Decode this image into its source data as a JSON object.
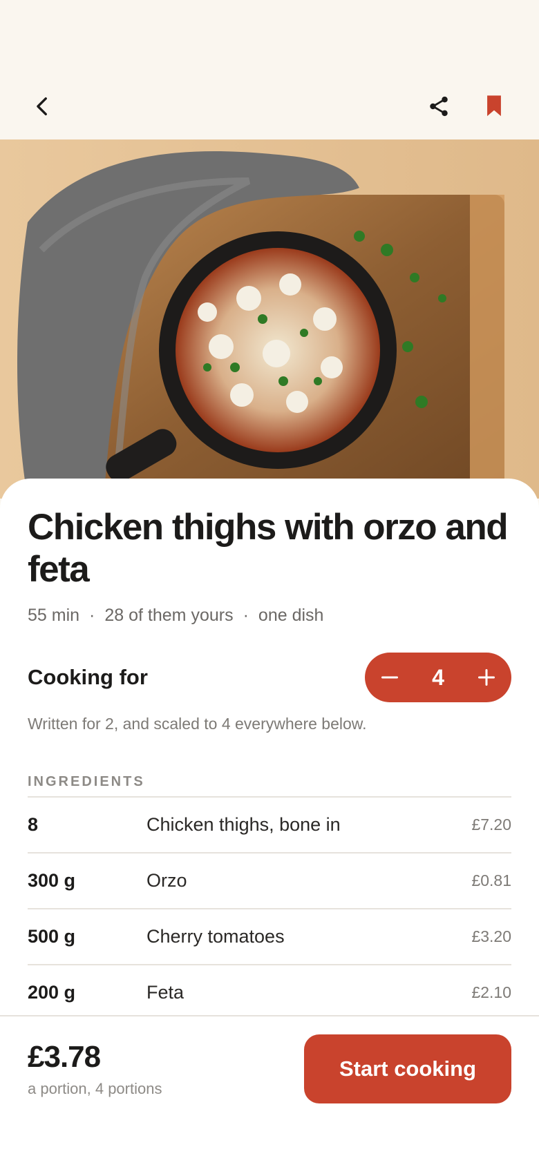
{
  "header": {
    "back_icon": "chevron-left-icon",
    "share_icon": "share-icon",
    "bookmark_icon": "bookmark-icon",
    "accent": "#c9432d"
  },
  "recipe": {
    "title": "Chicken thighs with orzo and feta",
    "time": "55 min",
    "active": "28 of them yours",
    "equipment": "one dish",
    "separator": "·"
  },
  "servings": {
    "label": "Cooking for",
    "value": "4",
    "minus_icon": "minus-icon",
    "plus_icon": "plus-icon",
    "note": "Written for 2, and scaled to 4 everywhere below."
  },
  "ingredients": {
    "heading": "INGREDIENTS",
    "items": [
      {
        "qty": "8",
        "name": "Chicken thighs, bone in",
        "price": "£7.20"
      },
      {
        "qty": "300 g",
        "name": "Orzo",
        "price": "£0.81"
      },
      {
        "qty": "500 g",
        "name": "Cherry tomatoes",
        "price": "£3.20"
      },
      {
        "qty": "200 g",
        "name": "Feta",
        "price": "£2.10"
      }
    ]
  },
  "footer": {
    "total": "£3.78",
    "total_sub": "a portion, 4 portions",
    "start_label": "Start cooking"
  }
}
